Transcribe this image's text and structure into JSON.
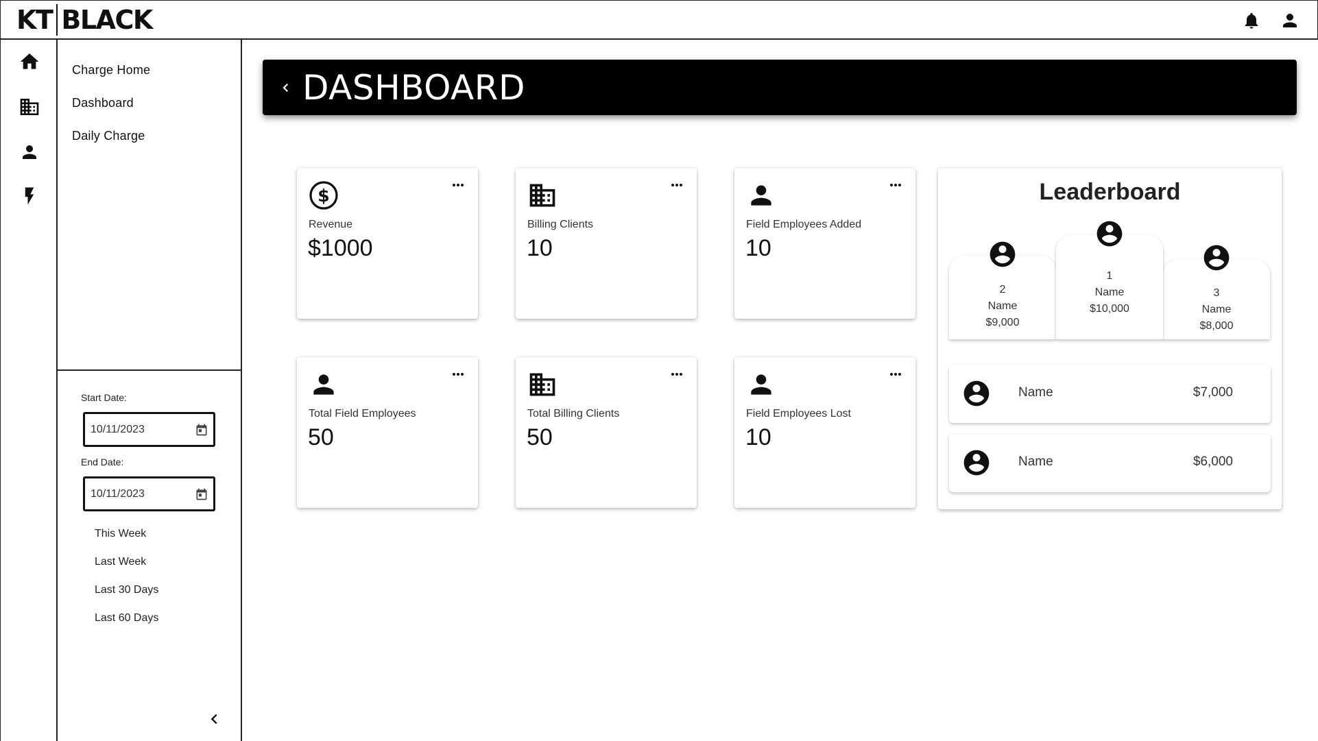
{
  "logo": {
    "left": "KT",
    "right": "BLACK"
  },
  "sidebar": {
    "links": [
      {
        "label": "Charge Home"
      },
      {
        "label": "Dashboard"
      },
      {
        "label": "Daily Charge"
      }
    ],
    "start_date_label": "Start Date:",
    "start_date_value": "10/11/2023",
    "end_date_label": "End Date:",
    "end_date_value": "10/11/2023",
    "quick_ranges": [
      "This Week",
      "Last Week",
      "Last 30 Days",
      "Last 60 Days"
    ]
  },
  "header": {
    "title": "DASHBOARD"
  },
  "cards": [
    {
      "label": "Revenue",
      "value": "$1000",
      "icon": "dollar-circle-icon"
    },
    {
      "label": "Billing Clients",
      "value": "10",
      "icon": "building-icon"
    },
    {
      "label": "Field Employees Added",
      "value": "10",
      "icon": "person-icon"
    },
    {
      "label": "Total Field Employees",
      "value": "50",
      "icon": "person-icon"
    },
    {
      "label": "Total Billing Clients",
      "value": "50",
      "icon": "building-icon"
    },
    {
      "label": "Field Employees Lost",
      "value": "10",
      "icon": "person-icon"
    }
  ],
  "leaderboard": {
    "title": "Leaderboard",
    "podium": {
      "first": {
        "rank": "1",
        "name": "Name",
        "amount": "$10,000"
      },
      "second": {
        "rank": "2",
        "name": "Name",
        "amount": "$9,000"
      },
      "third": {
        "rank": "3",
        "name": "Name",
        "amount": "$8,000"
      }
    },
    "rows": [
      {
        "name": "Name",
        "amount": "$7,000"
      },
      {
        "name": "Name",
        "amount": "$6,000"
      }
    ]
  },
  "colors": {
    "header_bg": "#000000",
    "text": "#222222",
    "accent": "#111111"
  }
}
